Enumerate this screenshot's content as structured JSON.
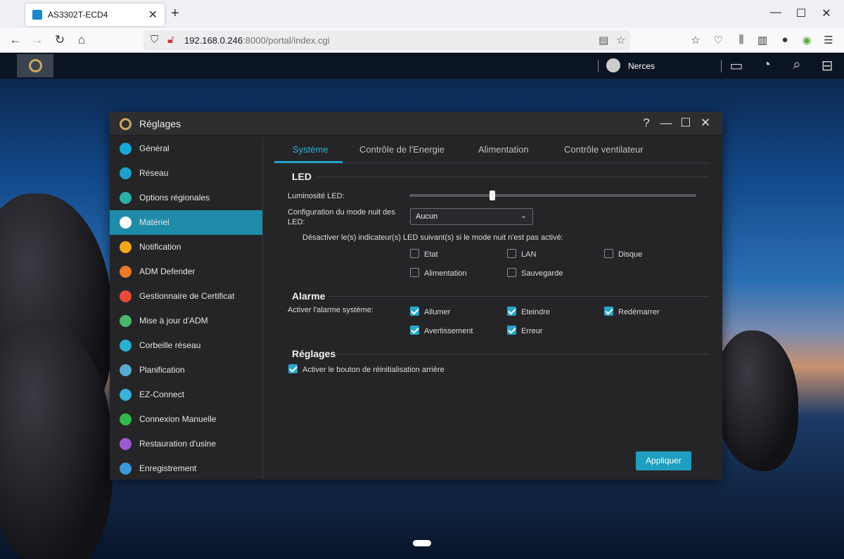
{
  "browser": {
    "tab_title": "AS3302T-ECD4",
    "tab_close": "✕",
    "new_tab": "+",
    "url_host": "192.168.0.246",
    "url_path": ":8000/portal/index.cgi",
    "window_controls": [
      "—",
      "☐",
      "✕"
    ]
  },
  "desktop": {
    "user_name": "Nerces"
  },
  "window": {
    "title": "Réglages",
    "help": "?",
    "minimize": "—",
    "maximize": "☐",
    "close": "✕"
  },
  "sidebar": {
    "items": [
      {
        "label": "Général",
        "icon": "general-icon",
        "color": "#16a8d8"
      },
      {
        "label": "Réseau",
        "icon": "globe-icon",
        "color": "#1fa0c8"
      },
      {
        "label": "Options régionales",
        "icon": "region-icon",
        "color": "#2bb0a8"
      },
      {
        "label": "Matériel",
        "icon": "hardware-icon",
        "color": "#ffffff"
      },
      {
        "label": "Notification",
        "icon": "alert-icon",
        "color": "#f3a61b"
      },
      {
        "label": "ADM Defender",
        "icon": "firewall-icon",
        "color": "#e87a2a"
      },
      {
        "label": "Gestionnaire de Certificat",
        "icon": "certificate-icon",
        "color": "#e84a3a"
      },
      {
        "label": "Mise à jour d'ADM",
        "icon": "update-icon",
        "color": "#4ab86a"
      },
      {
        "label": "Corbeille réseau",
        "icon": "recycle-icon",
        "color": "#2bb0d0"
      },
      {
        "label": "Planification",
        "icon": "schedule-icon",
        "color": "#5aaad0"
      },
      {
        "label": "EZ-Connect",
        "icon": "cloud-icon",
        "color": "#3ab0d8"
      },
      {
        "label": "Connexion Manuelle",
        "icon": "connection-icon",
        "color": "#2fb84a"
      },
      {
        "label": "Restauration d'usine",
        "icon": "restore-icon",
        "color": "#9a5ad0"
      },
      {
        "label": "Enregistrement",
        "icon": "register-icon",
        "color": "#3a9ad8"
      }
    ],
    "active_index": 3
  },
  "tabs": [
    "Système",
    "Contrôle de l'Energie",
    "Alimentation",
    "Contrôle ventilateur"
  ],
  "active_tab": 0,
  "led": {
    "title": "LED",
    "brightness_label": "Luminosité LED:",
    "brightness_level": 0.29,
    "night_mode_label": "Configuration du mode nuit des LED:",
    "night_mode_value": "Aucun",
    "disable_hint": "Désactiver le(s) indicateur(s) LED suivant(s) si le mode nuit n'est pas activé:",
    "indicators": [
      {
        "label": "Etat",
        "checked": false
      },
      {
        "label": "LAN",
        "checked": false
      },
      {
        "label": "Disque",
        "checked": false
      },
      {
        "label": "Alimentation",
        "checked": false
      },
      {
        "label": "Sauvegarde",
        "checked": false
      }
    ]
  },
  "alarm": {
    "title": "Alarme",
    "enable_label": "Activer l'alarme système:",
    "options": [
      {
        "label": "Allumer",
        "checked": true
      },
      {
        "label": "Eteindre",
        "checked": true
      },
      {
        "label": "Redémarrer",
        "checked": true
      },
      {
        "label": "Avertissement",
        "checked": true
      },
      {
        "label": "Erreur",
        "checked": true
      }
    ]
  },
  "settings": {
    "title": "Réglages",
    "reset_button_label": "Activer le bouton de réinitialisation arrière",
    "reset_button_checked": true
  },
  "apply_label": "Appliquer",
  "accent_color": "#1e9fbf"
}
